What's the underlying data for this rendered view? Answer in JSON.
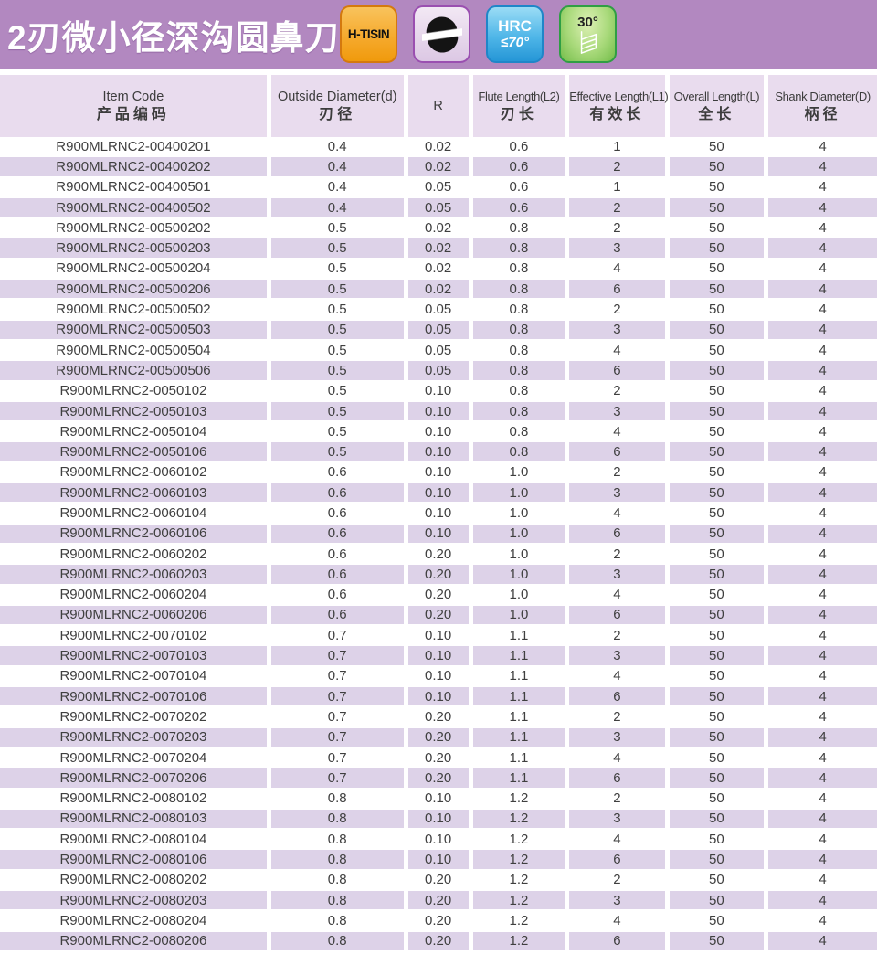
{
  "page": {
    "title": "2刃微小径深沟圆鼻刀"
  },
  "colors": {
    "band_purple": "#b288c0",
    "header_lavender": "#e9dcee",
    "row_stripe": "#ddd2e8",
    "badge_orange": "#f5a82a",
    "badge_blue": "#4fb6e8",
    "badge_green": "#8fcd60",
    "badge_lavender": "#e6d4ea"
  },
  "badges": [
    {
      "name": "h-tisin-coating-badge",
      "label": "H-TISIN"
    },
    {
      "name": "ball-nose-cutter-badge",
      "icon": "ball-nose-endmill-icon"
    },
    {
      "name": "hardness-badge",
      "line1": "HRC",
      "line2": "≤70°"
    },
    {
      "name": "helix-angle-badge",
      "label": "30°",
      "icon": "helix-hatch-icon"
    }
  ],
  "table": {
    "columns": [
      {
        "en": "Item Code",
        "zh": "产品编码"
      },
      {
        "en": "Outside Diameter(d)",
        "zh": "刃径"
      },
      {
        "en": "R",
        "zh": ""
      },
      {
        "en": "Flute Length(L2)",
        "zh": "刃长"
      },
      {
        "en": "Effective Length(L1)",
        "zh": "有效长"
      },
      {
        "en": "Overall Length(L)",
        "zh": "全长"
      },
      {
        "en": "Shank Diameter(D)",
        "zh": "柄径"
      }
    ],
    "rows": [
      [
        "R900MLRNC2-00400201",
        "0.4",
        "0.02",
        "0.6",
        "1",
        "50",
        "4"
      ],
      [
        "R900MLRNC2-00400202",
        "0.4",
        "0.02",
        "0.6",
        "2",
        "50",
        "4"
      ],
      [
        "R900MLRNC2-00400501",
        "0.4",
        "0.05",
        "0.6",
        "1",
        "50",
        "4"
      ],
      [
        "R900MLRNC2-00400502",
        "0.4",
        "0.05",
        "0.6",
        "2",
        "50",
        "4"
      ],
      [
        "R900MLRNC2-00500202",
        "0.5",
        "0.02",
        "0.8",
        "2",
        "50",
        "4"
      ],
      [
        "R900MLRNC2-00500203",
        "0.5",
        "0.02",
        "0.8",
        "3",
        "50",
        "4"
      ],
      [
        "R900MLRNC2-00500204",
        "0.5",
        "0.02",
        "0.8",
        "4",
        "50",
        "4"
      ],
      [
        "R900MLRNC2-00500206",
        "0.5",
        "0.02",
        "0.8",
        "6",
        "50",
        "4"
      ],
      [
        "R900MLRNC2-00500502",
        "0.5",
        "0.05",
        "0.8",
        "2",
        "50",
        "4"
      ],
      [
        "R900MLRNC2-00500503",
        "0.5",
        "0.05",
        "0.8",
        "3",
        "50",
        "4"
      ],
      [
        "R900MLRNC2-00500504",
        "0.5",
        "0.05",
        "0.8",
        "4",
        "50",
        "4"
      ],
      [
        "R900MLRNC2-00500506",
        "0.5",
        "0.05",
        "0.8",
        "6",
        "50",
        "4"
      ],
      [
        "R900MLRNC2-0050102",
        "0.5",
        "0.10",
        "0.8",
        "2",
        "50",
        "4"
      ],
      [
        "R900MLRNC2-0050103",
        "0.5",
        "0.10",
        "0.8",
        "3",
        "50",
        "4"
      ],
      [
        "R900MLRNC2-0050104",
        "0.5",
        "0.10",
        "0.8",
        "4",
        "50",
        "4"
      ],
      [
        "R900MLRNC2-0050106",
        "0.5",
        "0.10",
        "0.8",
        "6",
        "50",
        "4"
      ],
      [
        "R900MLRNC2-0060102",
        "0.6",
        "0.10",
        "1.0",
        "2",
        "50",
        "4"
      ],
      [
        "R900MLRNC2-0060103",
        "0.6",
        "0.10",
        "1.0",
        "3",
        "50",
        "4"
      ],
      [
        "R900MLRNC2-0060104",
        "0.6",
        "0.10",
        "1.0",
        "4",
        "50",
        "4"
      ],
      [
        "R900MLRNC2-0060106",
        "0.6",
        "0.10",
        "1.0",
        "6",
        "50",
        "4"
      ],
      [
        "R900MLRNC2-0060202",
        "0.6",
        "0.20",
        "1.0",
        "2",
        "50",
        "4"
      ],
      [
        "R900MLRNC2-0060203",
        "0.6",
        "0.20",
        "1.0",
        "3",
        "50",
        "4"
      ],
      [
        "R900MLRNC2-0060204",
        "0.6",
        "0.20",
        "1.0",
        "4",
        "50",
        "4"
      ],
      [
        "R900MLRNC2-0060206",
        "0.6",
        "0.20",
        "1.0",
        "6",
        "50",
        "4"
      ],
      [
        "R900MLRNC2-0070102",
        "0.7",
        "0.10",
        "1.1",
        "2",
        "50",
        "4"
      ],
      [
        "R900MLRNC2-0070103",
        "0.7",
        "0.10",
        "1.1",
        "3",
        "50",
        "4"
      ],
      [
        "R900MLRNC2-0070104",
        "0.7",
        "0.10",
        "1.1",
        "4",
        "50",
        "4"
      ],
      [
        "R900MLRNC2-0070106",
        "0.7",
        "0.10",
        "1.1",
        "6",
        "50",
        "4"
      ],
      [
        "R900MLRNC2-0070202",
        "0.7",
        "0.20",
        "1.1",
        "2",
        "50",
        "4"
      ],
      [
        "R900MLRNC2-0070203",
        "0.7",
        "0.20",
        "1.1",
        "3",
        "50",
        "4"
      ],
      [
        "R900MLRNC2-0070204",
        "0.7",
        "0.20",
        "1.1",
        "4",
        "50",
        "4"
      ],
      [
        "R900MLRNC2-0070206",
        "0.7",
        "0.20",
        "1.1",
        "6",
        "50",
        "4"
      ],
      [
        "R900MLRNC2-0080102",
        "0.8",
        "0.10",
        "1.2",
        "2",
        "50",
        "4"
      ],
      [
        "R900MLRNC2-0080103",
        "0.8",
        "0.10",
        "1.2",
        "3",
        "50",
        "4"
      ],
      [
        "R900MLRNC2-0080104",
        "0.8",
        "0.10",
        "1.2",
        "4",
        "50",
        "4"
      ],
      [
        "R900MLRNC2-0080106",
        "0.8",
        "0.10",
        "1.2",
        "6",
        "50",
        "4"
      ],
      [
        "R900MLRNC2-0080202",
        "0.8",
        "0.20",
        "1.2",
        "2",
        "50",
        "4"
      ],
      [
        "R900MLRNC2-0080203",
        "0.8",
        "0.20",
        "1.2",
        "3",
        "50",
        "4"
      ],
      [
        "R900MLRNC2-0080204",
        "0.8",
        "0.20",
        "1.2",
        "4",
        "50",
        "4"
      ],
      [
        "R900MLRNC2-0080206",
        "0.8",
        "0.20",
        "1.2",
        "6",
        "50",
        "4"
      ]
    ]
  }
}
